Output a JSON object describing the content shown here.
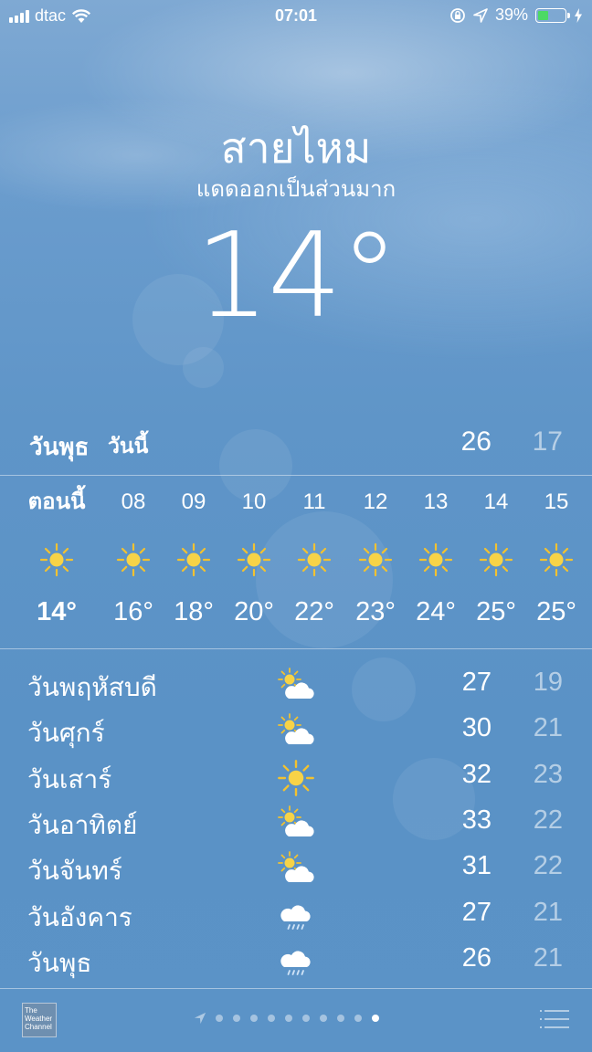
{
  "status_bar": {
    "carrier": "dtac",
    "time": "07:01",
    "battery_percent": "39%",
    "battery_level": 0.39,
    "battery_color": "#4cd964"
  },
  "location": {
    "city": "สายไหม",
    "condition": "แดดออกเป็นส่วนมาก",
    "temperature": "14°"
  },
  "today": {
    "day": "วันพุธ",
    "label": "วันนี้",
    "high": "26",
    "low": "17"
  },
  "hourly": [
    {
      "time": "ตอนนี้",
      "icon": "sun-icon",
      "temp": "14°"
    },
    {
      "time": "08",
      "icon": "sun-icon",
      "temp": "16°"
    },
    {
      "time": "09",
      "icon": "sun-icon",
      "temp": "18°"
    },
    {
      "time": "10",
      "icon": "sun-icon",
      "temp": "20°"
    },
    {
      "time": "11",
      "icon": "sun-icon",
      "temp": "22°"
    },
    {
      "time": "12",
      "icon": "sun-icon",
      "temp": "23°"
    },
    {
      "time": "13",
      "icon": "sun-icon",
      "temp": "24°"
    },
    {
      "time": "14",
      "icon": "sun-icon",
      "temp": "25°"
    },
    {
      "time": "15",
      "icon": "sun-icon",
      "temp": "25°"
    }
  ],
  "daily": [
    {
      "day": "วันพฤหัสบดี",
      "icon": "partly-cloudy-icon",
      "high": "27",
      "low": "19"
    },
    {
      "day": "วันศุกร์",
      "icon": "partly-cloudy-icon",
      "high": "30",
      "low": "21"
    },
    {
      "day": "วันเสาร์",
      "icon": "sun-icon",
      "high": "32",
      "low": "23"
    },
    {
      "day": "วันอาทิตย์",
      "icon": "partly-cloudy-icon",
      "high": "33",
      "low": "22"
    },
    {
      "day": "วันจันทร์",
      "icon": "partly-cloudy-icon",
      "high": "31",
      "low": "22"
    },
    {
      "day": "วันอังคาร",
      "icon": "rain-icon",
      "high": "27",
      "low": "21"
    },
    {
      "day": "วันพุธ",
      "icon": "rain-icon",
      "high": "26",
      "low": "21"
    }
  ],
  "footer": {
    "logo_text": "The Weather Channel",
    "page_count": 10,
    "active_page": 10
  },
  "colors": {
    "sun": "#f7d347",
    "sun_ray": "#f2c230"
  }
}
